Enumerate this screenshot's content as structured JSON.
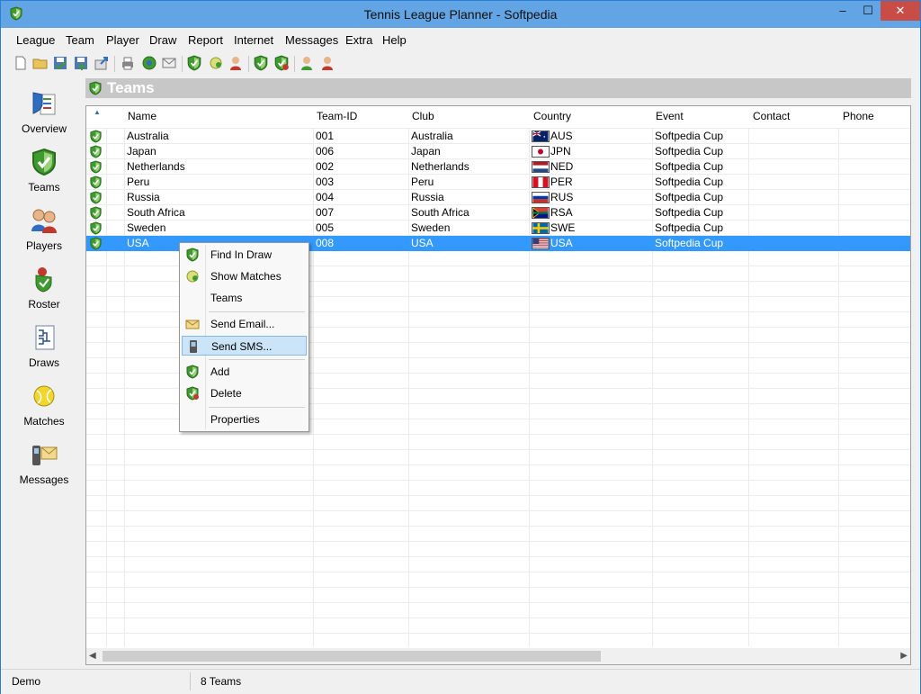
{
  "window": {
    "title": "Tennis League Planner - Softpedia",
    "minimize": "–",
    "maximize": "☐",
    "close": "✕"
  },
  "menu": [
    "League",
    "Team",
    "Player",
    "Draw",
    "Report",
    "Internet",
    "Messages",
    "Extra",
    "Help"
  ],
  "toolbar_icons": [
    "new-file-icon",
    "open-folder-icon",
    "save-icon",
    "save-all-icon",
    "export-icon",
    "print-icon",
    "web-icon",
    "email-icon",
    "team-shield-icon",
    "ball-icon",
    "player-icon",
    "add-team-icon",
    "edit-team-icon",
    "add-player-icon",
    "remove-player-icon"
  ],
  "nav": [
    {
      "label": "Overview",
      "icon": "overview-icon"
    },
    {
      "label": "Teams",
      "icon": "shield-icon"
    },
    {
      "label": "Players",
      "icon": "players-icon"
    },
    {
      "label": "Roster",
      "icon": "roster-icon"
    },
    {
      "label": "Draws",
      "icon": "draws-icon"
    },
    {
      "label": "Matches",
      "icon": "tennis-ball-icon"
    },
    {
      "label": "Messages",
      "icon": "messages-icon"
    }
  ],
  "section": {
    "title": "Teams"
  },
  "grid": {
    "columns": [
      "Name",
      "Team-ID",
      "Club",
      "Country",
      "Event",
      "Contact",
      "Phone"
    ],
    "rows": [
      {
        "name": "Australia",
        "id": "001",
        "club": "Australia",
        "country": "AUS",
        "event": "Softpedia Cup",
        "contact": "",
        "phone": ""
      },
      {
        "name": "Japan",
        "id": "006",
        "club": "Japan",
        "country": "JPN",
        "event": "Softpedia Cup",
        "contact": "",
        "phone": ""
      },
      {
        "name": "Netherlands",
        "id": "002",
        "club": "Netherlands",
        "country": "NED",
        "event": "Softpedia Cup",
        "contact": "",
        "phone": ""
      },
      {
        "name": "Peru",
        "id": "003",
        "club": "Peru",
        "country": "PER",
        "event": "Softpedia Cup",
        "contact": "",
        "phone": ""
      },
      {
        "name": "Russia",
        "id": "004",
        "club": "Russia",
        "country": "RUS",
        "event": "Softpedia Cup",
        "contact": "",
        "phone": ""
      },
      {
        "name": "South Africa",
        "id": "007",
        "club": "South Africa",
        "country": "RSA",
        "event": "Softpedia Cup",
        "contact": "",
        "phone": ""
      },
      {
        "name": "Sweden",
        "id": "005",
        "club": "Sweden",
        "country": "SWE",
        "event": "Softpedia Cup",
        "contact": "",
        "phone": ""
      },
      {
        "name": "USA",
        "id": "008",
        "club": "USA",
        "country": "USA",
        "event": "Softpedia Cup",
        "contact": "",
        "phone": ""
      }
    ],
    "selected_row": 7
  },
  "context_menu": {
    "items": [
      {
        "label": "Find In Draw",
        "icon": "find-draw-icon"
      },
      {
        "label": "Show Matches",
        "icon": "matches-icon"
      },
      {
        "label": "Teams",
        "icon": ""
      },
      {
        "label": "Send Email...",
        "icon": "envelope-icon"
      },
      {
        "label": "Send SMS...",
        "icon": "phone-icon"
      },
      {
        "label": "Add",
        "icon": "add-icon"
      },
      {
        "label": "Delete",
        "icon": "delete-icon"
      },
      {
        "label": "Properties",
        "icon": ""
      }
    ],
    "highlighted": 4
  },
  "status": {
    "left": "Demo",
    "right": "8 Teams"
  },
  "colors": {
    "titlebar": "#62a4e4",
    "close": "#c74d46",
    "selection": "#3399ff",
    "menu_highlight": "#cce4f7",
    "shield_green": "#3f9b2f"
  }
}
